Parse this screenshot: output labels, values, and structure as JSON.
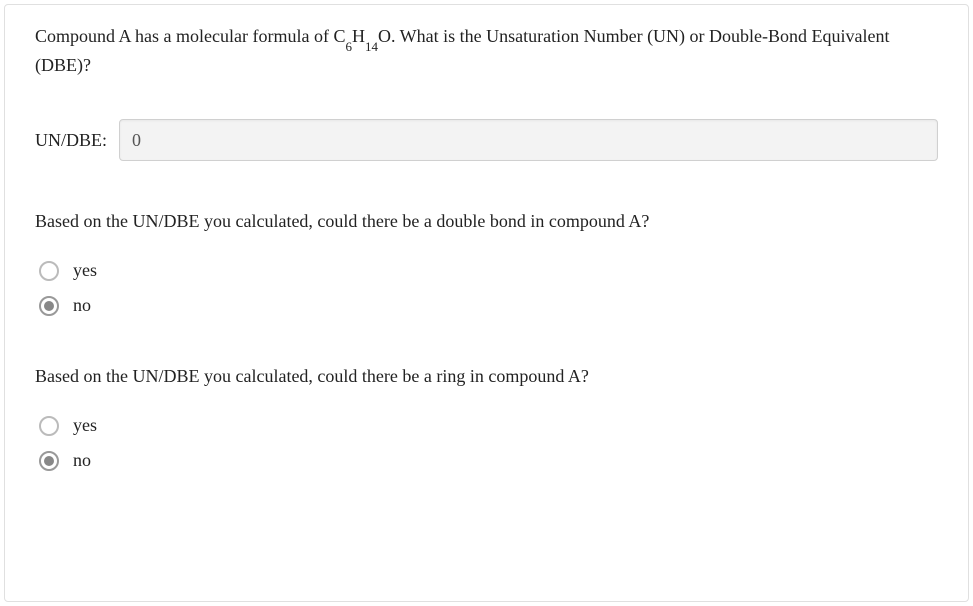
{
  "question": {
    "prefix": "Compound A has a molecular formula of C",
    "sub1": "6",
    "mid1": "H",
    "sub2": "14",
    "suffix": "O. What is the Unsaturation Number (UN) or Double-Bond Equivalent (DBE)?"
  },
  "input": {
    "label": "UN/DBE:",
    "value": "0"
  },
  "subq1": {
    "text": "Based on the UN/DBE you calculated, could there be a double bond in compound A?",
    "options": [
      {
        "label": "yes",
        "selected": false
      },
      {
        "label": "no",
        "selected": true
      }
    ]
  },
  "subq2": {
    "text": "Based on the UN/DBE you calculated, could there be a ring in compound A?",
    "options": [
      {
        "label": "yes",
        "selected": false
      },
      {
        "label": "no",
        "selected": true
      }
    ]
  }
}
